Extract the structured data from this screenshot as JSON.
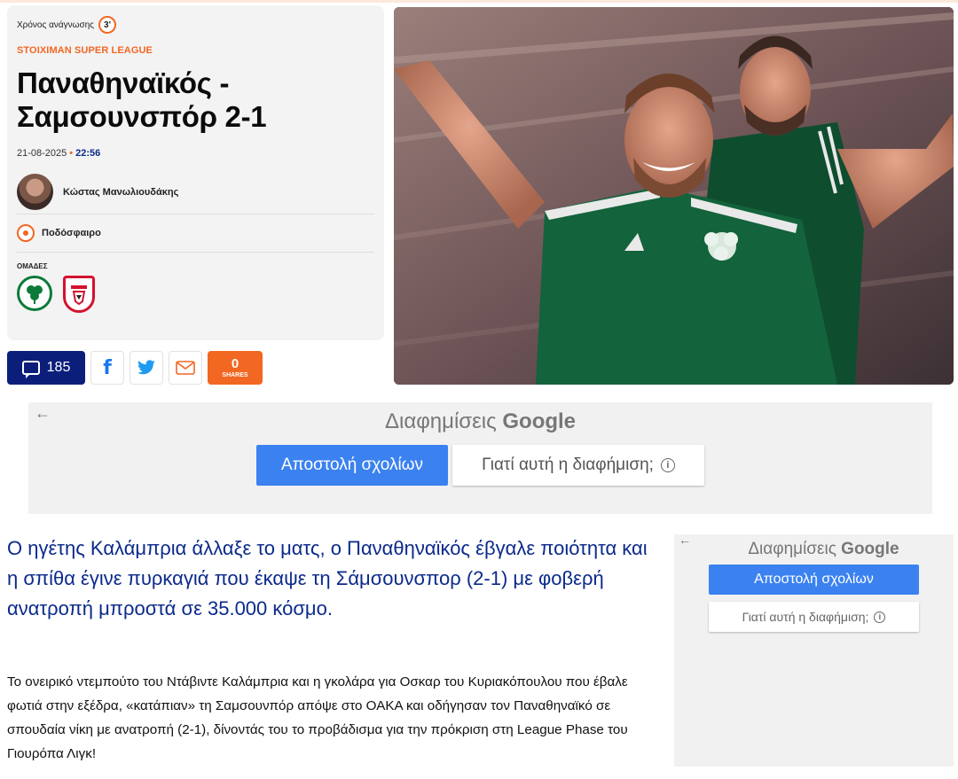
{
  "article": {
    "reading_time_label": "Χρόνος ανάγνωσης",
    "reading_time_value": "3'",
    "league": "STOIXIMAN SUPER LEAGUE",
    "title": "Παναθηναϊκός - Σαμσουνσπόρ 2-1",
    "date": "21-08-2025",
    "time": "22:56",
    "author": "Κώστας Μανωλιουδάκης",
    "sport": "Ποδόσφαιρο",
    "teams_label": "ΟΜΑΔΕΣ",
    "teams": [
      "Παναθηναϊκός",
      "Σαμσουνσπόρ"
    ],
    "lead": "Ο ηγέτης Καλάμπρια άλλαξε το ματς, ο Παναθηναϊκός έβγαλε ποιότητα και η σπίθα έγινε πυρκαγιά που έκαψε τη Σάμσουνσπορ (2-1) με φοβερή ανατροπή μπροστά σε 35.000 κόσμο.",
    "body": "Το ονειρικό ντεμπούτο του Ντάβιντε Καλάμπρια και η γκολάρα για Οσκαρ του Κυριακόπουλου που έβαλε φωτιά στην εξέδρα, «κατάπιαν» τη Σαμσουνπόρ απόψε στο ΟΑΚΑ και οδήγησαν τον Παναθηναϊκό σε σπουδαία νίκη με ανατροπή (2-1), δίνοντάς του το προβάδισμα για την πρόκριση στη League Phase του Γιουρόπα Λιγκ!"
  },
  "share": {
    "comments_count": "185",
    "shares_count": "0",
    "shares_label": "SHARES"
  },
  "ads": {
    "title_prefix": "Διαφημίσεις",
    "title_brand": "Google",
    "send_feedback": "Αποστολή σχολίων",
    "why_this_ad": "Γιατί αυτή η διαφήμιση;",
    "back_arrow": "←",
    "info_symbol": "i"
  },
  "colors": {
    "accent_orange": "#f26722",
    "navy": "#0b1f7a",
    "lead_blue": "#0b2a8c",
    "pao_green": "#0d7a3a",
    "samsun_red": "#d3122e",
    "ad_blue": "#3b82f0"
  },
  "icons": [
    "comment-bubble-icon",
    "facebook-icon",
    "twitter-icon",
    "mail-icon",
    "football-icon",
    "arrow-left-icon",
    "info-icon"
  ]
}
